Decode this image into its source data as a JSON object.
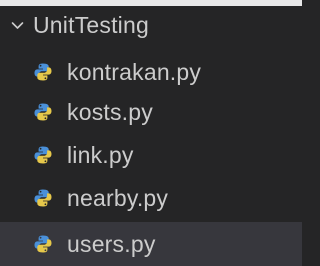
{
  "explorer": {
    "folder": {
      "label": "UnitTesting",
      "expanded": true,
      "icon": "chevron-down-icon"
    },
    "files": [
      {
        "label": "kontrakan.py",
        "icon": "python-file-icon",
        "selected": false
      },
      {
        "label": "kosts.py",
        "icon": "python-file-icon",
        "selected": false
      },
      {
        "label": "link.py",
        "icon": "python-file-icon",
        "selected": false
      },
      {
        "label": "nearby.py",
        "icon": "python-file-icon",
        "selected": false
      },
      {
        "label": "users.py",
        "icon": "python-file-icon",
        "selected": true
      }
    ]
  },
  "colors": {
    "background": "#252526",
    "selected_row": "#37373d",
    "text": "#cccccc",
    "python_blue": "#4a90d9",
    "python_yellow": "#e6c84b"
  }
}
